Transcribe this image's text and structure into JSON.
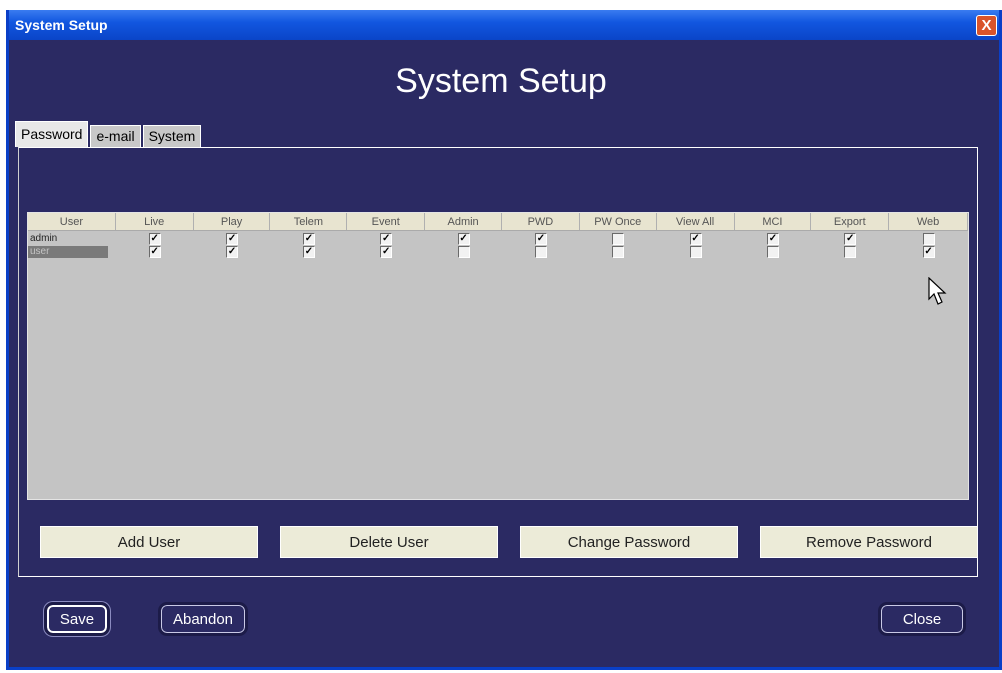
{
  "window": {
    "title": "System Setup",
    "close_glyph": "X"
  },
  "heading": "System Setup",
  "tabs": [
    {
      "label": "Password",
      "active": true
    },
    {
      "label": "e-mail",
      "active": false
    },
    {
      "label": "System",
      "active": false
    }
  ],
  "table": {
    "columns": [
      "User",
      "Live",
      "Play",
      "Telem",
      "Event",
      "Admin",
      "PWD",
      "PW Once",
      "View All",
      "MCI",
      "Export",
      "Web"
    ],
    "rows": [
      {
        "user": "admin",
        "selected": false,
        "perms": [
          true,
          true,
          true,
          true,
          true,
          true,
          false,
          true,
          true,
          true,
          false
        ]
      },
      {
        "user": "user",
        "selected": true,
        "perms": [
          true,
          true,
          true,
          true,
          false,
          false,
          false,
          false,
          false,
          false,
          true
        ]
      }
    ]
  },
  "user_buttons": {
    "add_user": "Add User",
    "delete_user": "Delete User",
    "change_password": "Change Password",
    "remove_password": "Remove Password"
  },
  "nav_buttons": {
    "save": "Save",
    "abandon": "Abandon",
    "close": "Close"
  },
  "checkmark_glyph": "✓",
  "colors": {
    "background": "#2b2a63",
    "titlebar": "#1257e0",
    "grid": "#c4c4c4",
    "header": "#e8e4d0",
    "close_button": "#d9542b"
  }
}
